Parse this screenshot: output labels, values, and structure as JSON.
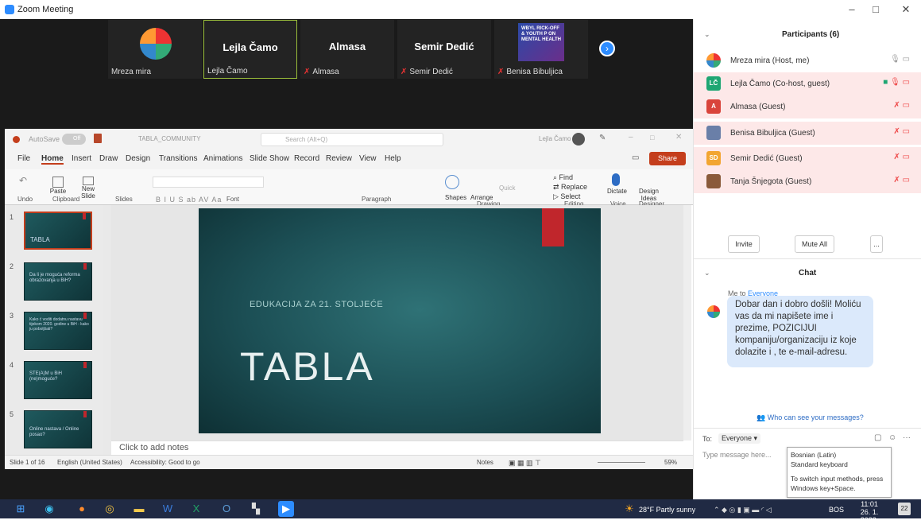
{
  "window": {
    "title": "Zoom Meeting",
    "minimize": "–",
    "restore": "□",
    "close": "✕"
  },
  "video_strip": {
    "tiles": [
      {
        "name": "",
        "label": "Mreza mira",
        "muted": false
      },
      {
        "name": "Lejla Čamo",
        "label": "Lejla Čamo",
        "muted": false
      },
      {
        "name": "Almasa",
        "label": "Almasa",
        "muted": true
      },
      {
        "name": "Semir Dedić",
        "label": "Semir Dedić",
        "muted": true
      },
      {
        "name": "",
        "label": "Benisa Bibuljica",
        "muted": true
      }
    ],
    "thumb_text": "WBYL RICK-OFF & YOUTH P ON MENTAL HEALTH",
    "next_icon": "chevron-right-icon"
  },
  "ppt": {
    "autosave_label": "AutoSave",
    "autosave_state": "Off",
    "doc_title": "TABLA_COMMUNITY",
    "search_placeholder": "Search (Alt+Q)",
    "user_name": "Lejla Čamo",
    "menu": [
      "File",
      "Home",
      "Insert",
      "Draw",
      "Design",
      "Transitions",
      "Animations",
      "Slide Show",
      "Record",
      "Review",
      "View",
      "Help"
    ],
    "share_label": "Share",
    "groups": {
      "undo": "Undo",
      "clipboard": "Clipboard",
      "slides": "Slides",
      "font": "Font",
      "paragraph": "Paragraph",
      "drawing": "Drawing",
      "editing": "Editing",
      "voice": "Voice",
      "designer": "Designer"
    },
    "buttons": {
      "paste": "Paste",
      "new_slide": "New",
      "new_slide2": "Slide",
      "shapes": "Shapes",
      "arrange": "Arrange",
      "quick_styles": "Quick",
      "quick_styles2": "Styles",
      "find": "Find",
      "replace": "Replace",
      "select": "Select",
      "dictate": "Dictate",
      "design_ideas": "Design",
      "design_ideas2": "Ideas"
    },
    "font_chars": "B  I  U  S  ab  AV  Aa",
    "thumbnails": [
      {
        "num": "1",
        "text": "TABLA"
      },
      {
        "num": "2",
        "text": "Da li je moguća reforma obrazovanja u BiH?"
      },
      {
        "num": "3",
        "text": "Kako ć voditi dodatnu nastavu tijekom 2020. godine u BiH - kako ju poboljšati?"
      },
      {
        "num": "4",
        "text": "STE(A)M u BiH (ne)moguće?"
      },
      {
        "num": "5",
        "text": "Online nastava / Online posao?"
      }
    ],
    "slide": {
      "subtitle": "EDUKACIJA ZA 21. STOLJEĆE",
      "title": "TABLA"
    },
    "notes_placeholder": "Click to add notes",
    "status": {
      "slide": "Slide 1 of 16",
      "lang": "English (United States)",
      "access": "Accessibility: Good to go",
      "notes_btn": "Notes",
      "zoom": "59%"
    }
  },
  "participants": {
    "header": "Participants (6)",
    "list": [
      {
        "name": "Mreza mira (Host, me)",
        "initials": "",
        "color": "#ffffff",
        "bg": false
      },
      {
        "name": "Lejla Čamo (Co-host, guest)",
        "initials": "LČ",
        "color": "#1ea672",
        "bg": true
      },
      {
        "name": "Almasa (Guest)",
        "initials": "A",
        "color": "#d9443b",
        "bg": true
      },
      {
        "name": "Benisa Bibuljica (Guest)",
        "initials": "",
        "color": "#6a7fa8",
        "bg": true
      },
      {
        "name": "Semir Dedić (Guest)",
        "initials": "SD",
        "color": "#f2a531",
        "bg": true
      },
      {
        "name": "Tanja Šnjegota (Guest)",
        "initials": "",
        "color": "#8a5a3a",
        "bg": true
      }
    ],
    "invite": "Invite",
    "mute_all": "Mute All",
    "more": "..."
  },
  "chat": {
    "header": "Chat",
    "me_to": "Me to",
    "everyone": "Everyone",
    "message": "Dobar dan i dobro došli!  Moliću vas da mi napišete ime i prezime, POZICIJUI kompaniju/organizaciju iz koje dolazite i , te e-mail-adresu.",
    "who": "Who can see your messages?",
    "to_label": "To:",
    "to_value": "Everyone",
    "input_placeholder": "Type message here..."
  },
  "ime": {
    "line1": "Bosnian (Latin)",
    "line2": "Standard keyboard",
    "line3": "To switch input methods, press Windows key+Space."
  },
  "taskbar": {
    "weather": "28°F  Partly sunny",
    "lang": "BOS",
    "time": "11:01",
    "date": "26. 1. 2022.",
    "notif": "22"
  }
}
